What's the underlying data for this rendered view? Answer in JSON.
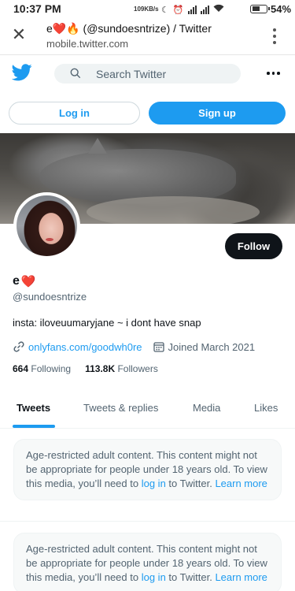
{
  "status_bar": {
    "time": "10:37 PM",
    "net_speed": "109KB/s",
    "battery_pct": "54%"
  },
  "browser": {
    "title": "e❤️🔥 (@sundoesntrize) / Twitter",
    "url": "mobile.twitter.com"
  },
  "header": {
    "search_placeholder": "Search Twitter"
  },
  "auth": {
    "login": "Log in",
    "signup": "Sign up"
  },
  "profile": {
    "follow_label": "Follow",
    "name": "e",
    "name_emoji": "❤️",
    "handle": "@sundoesntrize",
    "bio": "insta: iloveuumaryjane ~ i dont have snap",
    "link": "onlyfans.com/goodwh0re",
    "joined": "Joined March 2021",
    "following_count": "664",
    "following_label": "Following",
    "followers_count": "113.8K",
    "followers_label": "Followers"
  },
  "tabs": [
    "Tweets",
    "Tweets & replies",
    "Media",
    "Likes"
  ],
  "notice": {
    "text": "Age-restricted adult content. This content might not be appropriate for people under 18 years old. To view this media, you’ll need to",
    "login_link": "log in",
    "after_link": " to Twitter.",
    "learn_more": "Learn more"
  },
  "colors": {
    "accent": "#1d9bf0",
    "text": "#0f1419",
    "muted": "#536471"
  }
}
